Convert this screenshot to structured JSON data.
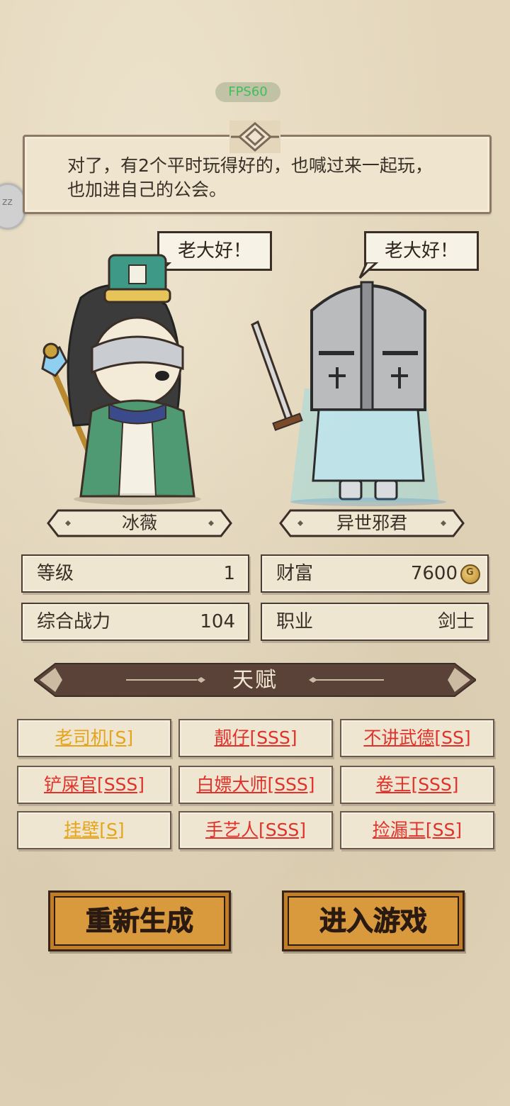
{
  "fps": "FPS60",
  "side_badge": "zz",
  "dialogue": {
    "line1": "对了，有2个平时玩得好的，也喊过来一起玩，",
    "line2": "也加进自己的公会。"
  },
  "characters": [
    {
      "speech": "老大好！",
      "name": "冰薇",
      "figure_icon": "bishop-character-icon"
    },
    {
      "speech": "老大好！",
      "name": "异世邪君",
      "figure_icon": "knight-character-icon"
    }
  ],
  "stats": {
    "level": {
      "label": "等级",
      "value": "1"
    },
    "wealth": {
      "label": "财富",
      "value": "7600",
      "icon": "gold-coin-icon"
    },
    "power": {
      "label": "综合战力",
      "value": "104"
    },
    "class": {
      "label": "职业",
      "value": "剑士"
    }
  },
  "talents_header": "天赋",
  "talents": [
    {
      "label": "老司机[S]",
      "color": "#e6a41a"
    },
    {
      "label": "靓仔[SSS]",
      "color": "#e0322a"
    },
    {
      "label": "不讲武德[SS]",
      "color": "#e0322a"
    },
    {
      "label": "铲屎官[SSS]",
      "color": "#e0322a"
    },
    {
      "label": "白嫖大师[SSS]",
      "color": "#e0322a"
    },
    {
      "label": "卷王[SSS]",
      "color": "#e0322a"
    },
    {
      "label": "挂壁[S]",
      "color": "#e6a41a"
    },
    {
      "label": "手艺人[SSS]",
      "color": "#e0322a"
    },
    {
      "label": "捡漏王[SS]",
      "color": "#e0322a"
    }
  ],
  "buttons": {
    "regenerate": "重新生成",
    "enter": "进入游戏"
  }
}
